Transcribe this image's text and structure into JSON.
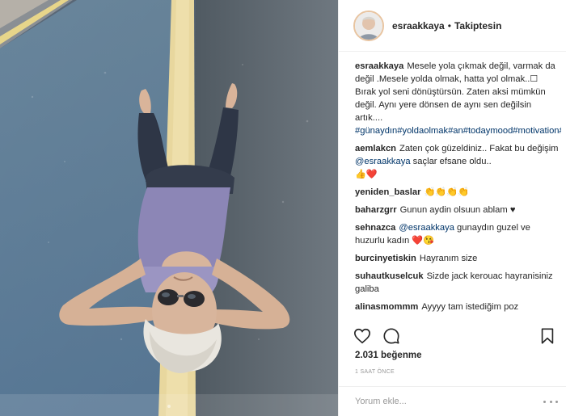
{
  "header": {
    "username": "esraakkaya",
    "separator": "•",
    "follow_status": "Takiptesin"
  },
  "caption": {
    "username": "esraakkaya",
    "text": "Mesele yola çıkmak değil, varmak da değil .Mesele yolda olmak, hatta yol olmak..☐ Bırak yol seni dönüştürsün. Zaten aksi mümkün değil. Aynı yere dönsen de aynı sen değilsin artık....",
    "hashtags": "#günaydın#yoldaolmak#an#todaymood#motivation#esragibigit#yolculuk#"
  },
  "comments": [
    {
      "username": "aemlakcn",
      "pre": "Zaten çok güzeldiniz.. Fakat bu değişim ",
      "mention": "@esraakkaya",
      "post": " saçlar efsane oldu..",
      "emoji": "👍❤️"
    },
    {
      "username": "yeniden_baslar",
      "pre": "",
      "mention": "",
      "post": "",
      "emoji": "👏👏👏👏"
    },
    {
      "username": "baharzgrr",
      "pre": "Gunun aydin olsuun ablam ♥",
      "mention": "",
      "post": "",
      "emoji": ""
    },
    {
      "username": "sehnazca",
      "pre": "",
      "mention": "@esraakkaya",
      "post": " gunaydın guzel ve huzurlu kadın ",
      "emoji": "❤️😘"
    },
    {
      "username": "burcinyetiskin",
      "pre": "Hayranım size",
      "mention": "",
      "post": "",
      "emoji": ""
    },
    {
      "username": "suhautkuselcuk",
      "pre": "Sizde jack kerouac hayranisiniz galiba",
      "mention": "",
      "post": "",
      "emoji": ""
    },
    {
      "username": "alinasmommm",
      "pre": "Ayyyy tam istediğim poz",
      "mention": "",
      "post": "",
      "emoji": ""
    }
  ],
  "actions": {
    "like_icon": "heart-icon",
    "comment_icon": "comment-icon",
    "save_icon": "bookmark-icon"
  },
  "likes": "2.031 beğenme",
  "timestamp": "1 SAAT ÖNCE",
  "add_comment": {
    "placeholder": "Yorum ekle..."
  },
  "colors": {
    "text": "#262626",
    "link": "#003569",
    "muted": "#999999",
    "border": "#efefef",
    "road": "#4a5868",
    "road_line": "#e9d79a"
  }
}
